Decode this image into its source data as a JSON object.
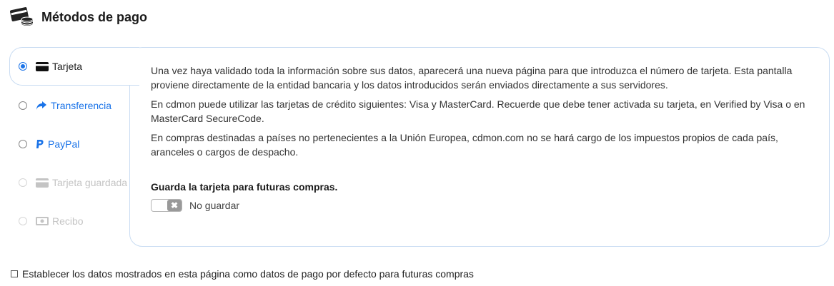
{
  "header": {
    "title": "Métodos de pago",
    "icon": "card-coins-icon"
  },
  "methods": [
    {
      "label": "Tarjeta",
      "icon": "credit-card-icon",
      "selected": true,
      "enabled": true
    },
    {
      "label": "Transferencia",
      "icon": "share-arrow-icon",
      "selected": false,
      "enabled": true
    },
    {
      "label": "PayPal",
      "icon": "paypal-icon",
      "selected": false,
      "enabled": true
    },
    {
      "label": "Tarjeta guardada",
      "icon": "credit-card-icon",
      "selected": false,
      "enabled": false
    },
    {
      "label": "Recibo",
      "icon": "money-bill-icon",
      "selected": false,
      "enabled": false
    }
  ],
  "content": {
    "paragraphs": [
      "Una vez haya validado toda la información sobre sus datos, aparecerá una nueva página para que introduzca el número de tarjeta. Esta pantalla proviene directamente de la entidad bancaria y los datos introducidos serán enviados directamente a sus servidores.",
      "En cdmon puede utilizar las tarjetas de crédito siguientes: Visa y MasterCard. Recuerde que debe tener activada su tarjeta, en Verified by Visa o en MasterCard SecureCode.",
      "En compras destinadas a países no pertenecientes a la Unión Europea, cdmon.com no se hará cargo de los impuestos propios de cada país, aranceles o cargos de despacho."
    ],
    "save_card": {
      "title": "Guarda la tarjeta para futuras compras.",
      "toggle_label": "No guardar",
      "toggle_on": false
    }
  },
  "default_option": {
    "label": "Establecer los datos mostrados en esta página como datos de pago por defecto para futuras compras",
    "checked": false
  },
  "colors": {
    "accent": "#1a73e8",
    "border": "#c9dcf2",
    "disabled": "#c4c4c4"
  }
}
